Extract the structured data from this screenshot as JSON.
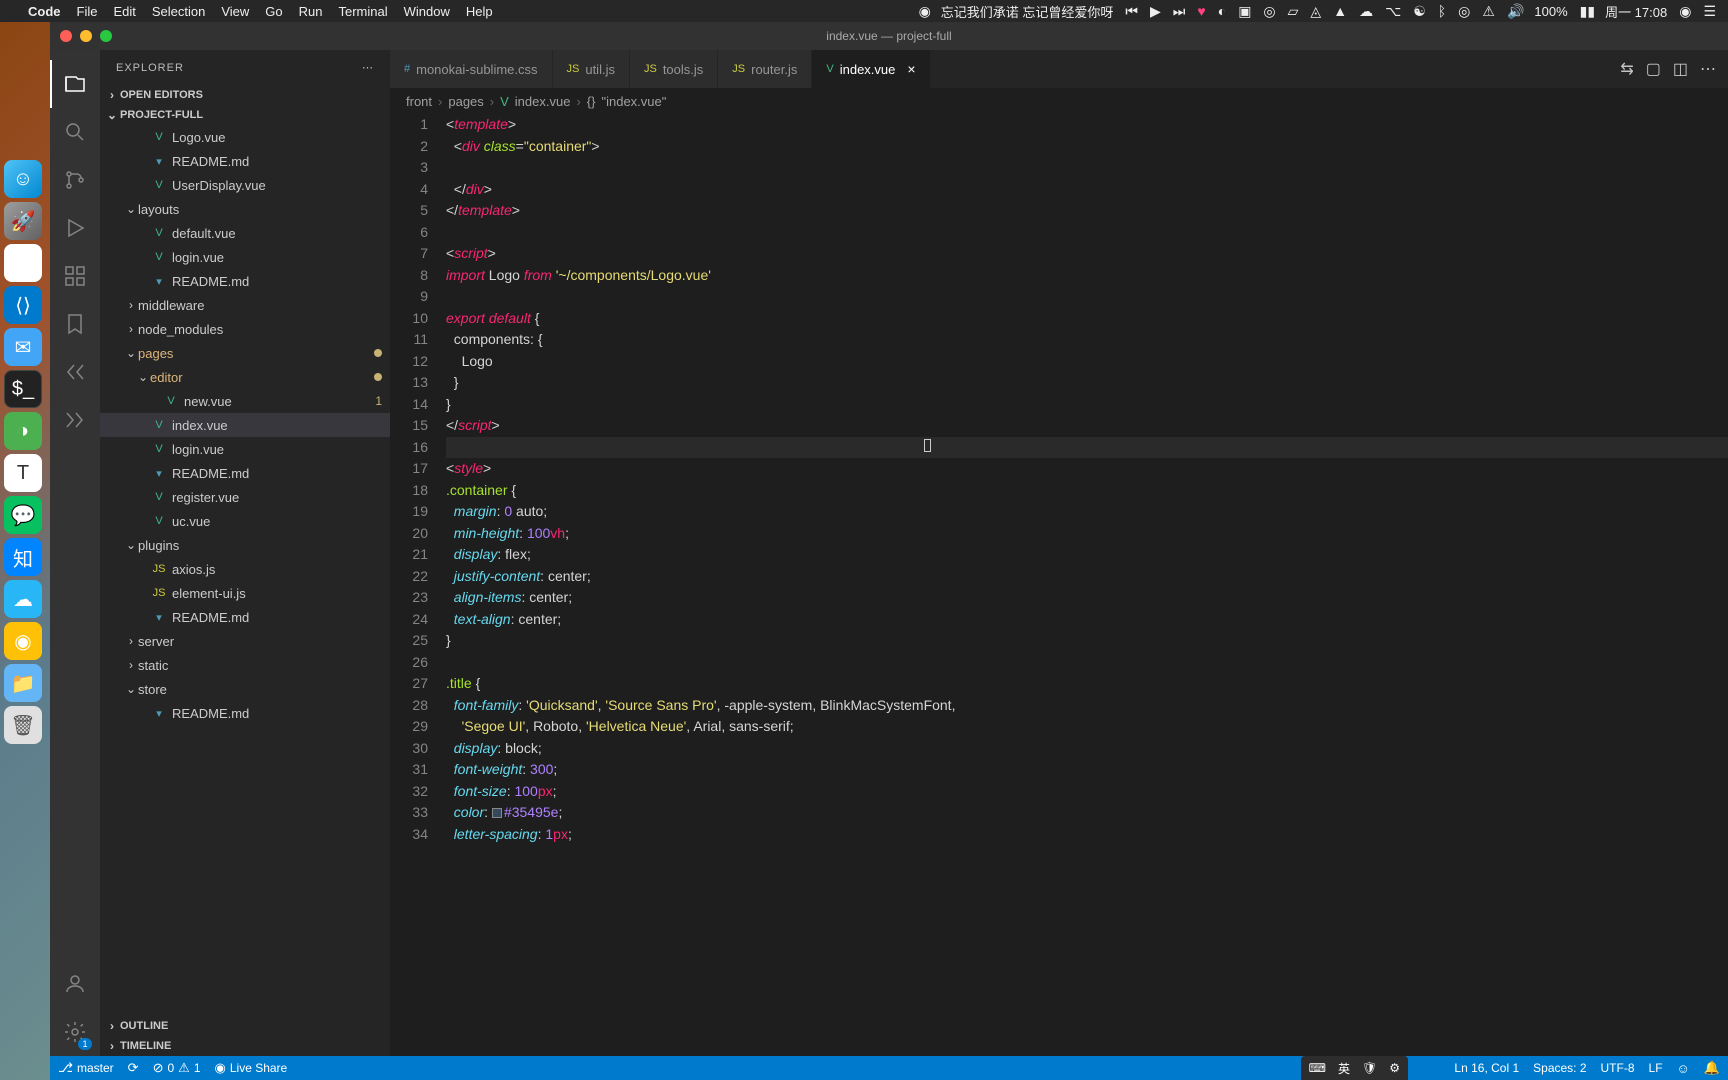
{
  "menubar": {
    "app": "Code",
    "items": [
      "File",
      "Edit",
      "Selection",
      "View",
      "Go",
      "Run",
      "Terminal",
      "Window",
      "Help"
    ],
    "nowplaying": "忘记我们承诺 忘记曾经爱你呀",
    "battery": "100%",
    "day_time": "周一 17:08"
  },
  "window": {
    "title": "index.vue — project-full"
  },
  "sidebar": {
    "title": "EXPLORER",
    "sections": {
      "open_editors": "OPEN EDITORS",
      "project": "PROJECT-FULL",
      "outline": "OUTLINE",
      "timeline": "TIMELINE"
    },
    "tree": [
      {
        "type": "file",
        "name": "Logo.vue",
        "icon": "vue",
        "indent": 3
      },
      {
        "type": "file",
        "name": "README.md",
        "icon": "md",
        "indent": 3
      },
      {
        "type": "file",
        "name": "UserDisplay.vue",
        "icon": "vue",
        "indent": 3
      },
      {
        "type": "folder",
        "name": "layouts",
        "open": true,
        "indent": 2
      },
      {
        "type": "file",
        "name": "default.vue",
        "icon": "vue",
        "indent": 3
      },
      {
        "type": "file",
        "name": "login.vue",
        "icon": "vue",
        "indent": 3
      },
      {
        "type": "file",
        "name": "README.md",
        "icon": "md",
        "indent": 3
      },
      {
        "type": "folder",
        "name": "middleware",
        "open": false,
        "indent": 2
      },
      {
        "type": "folder",
        "name": "node_modules",
        "open": false,
        "indent": 2
      },
      {
        "type": "folder",
        "name": "pages",
        "open": true,
        "indent": 2,
        "modified": true
      },
      {
        "type": "folder",
        "name": "editor",
        "open": true,
        "indent": 3,
        "modified": true
      },
      {
        "type": "file",
        "name": "new.vue",
        "icon": "vue",
        "indent": 4,
        "badge": "1"
      },
      {
        "type": "file",
        "name": "index.vue",
        "icon": "vue",
        "indent": 3,
        "active": true
      },
      {
        "type": "file",
        "name": "login.vue",
        "icon": "vue",
        "indent": 3
      },
      {
        "type": "file",
        "name": "README.md",
        "icon": "md",
        "indent": 3
      },
      {
        "type": "file",
        "name": "register.vue",
        "icon": "vue",
        "indent": 3
      },
      {
        "type": "file",
        "name": "uc.vue",
        "icon": "vue",
        "indent": 3
      },
      {
        "type": "folder",
        "name": "plugins",
        "open": true,
        "indent": 2
      },
      {
        "type": "file",
        "name": "axios.js",
        "icon": "js",
        "indent": 3
      },
      {
        "type": "file",
        "name": "element-ui.js",
        "icon": "js",
        "indent": 3
      },
      {
        "type": "file",
        "name": "README.md",
        "icon": "md",
        "indent": 3
      },
      {
        "type": "folder",
        "name": "server",
        "open": false,
        "indent": 2
      },
      {
        "type": "folder",
        "name": "static",
        "open": false,
        "indent": 2
      },
      {
        "type": "folder",
        "name": "store",
        "open": true,
        "indent": 2
      },
      {
        "type": "file",
        "name": "README.md",
        "icon": "md",
        "indent": 3
      }
    ]
  },
  "tabs": [
    {
      "name": "monokai-sublime.css",
      "icon": "#",
      "iconColor": "#519aba"
    },
    {
      "name": "util.js",
      "icon": "JS",
      "iconColor": "#cbcb41"
    },
    {
      "name": "tools.js",
      "icon": "JS",
      "iconColor": "#cbcb41"
    },
    {
      "name": "router.js",
      "icon": "JS",
      "iconColor": "#cbcb41"
    },
    {
      "name": "index.vue",
      "icon": "V",
      "iconColor": "#41b883",
      "active": true
    }
  ],
  "breadcrumb": [
    "front",
    "pages",
    "index.vue",
    "{}",
    "\"index.vue\""
  ],
  "code": {
    "lines": [
      {
        "n": 1,
        "html": "<span class='c-punc'>&lt;</span><span class='c-tag'>template</span><span class='c-punc'>&gt;</span>"
      },
      {
        "n": 2,
        "html": "  <span class='c-punc'>&lt;</span><span class='c-tag'>div</span> <span class='c-attr'>class</span><span class='c-punc'>=</span><span class='c-str'>\"container\"</span><span class='c-punc'>&gt;</span>"
      },
      {
        "n": 3,
        "html": ""
      },
      {
        "n": 4,
        "html": "  <span class='c-punc'>&lt;/</span><span class='c-tag'>div</span><span class='c-punc'>&gt;</span>"
      },
      {
        "n": 5,
        "html": "<span class='c-punc'>&lt;/</span><span class='c-tag'>template</span><span class='c-punc'>&gt;</span>"
      },
      {
        "n": 6,
        "html": ""
      },
      {
        "n": 7,
        "html": "<span class='c-punc'>&lt;</span><span class='c-tag'>script</span><span class='c-punc'>&gt;</span>"
      },
      {
        "n": 8,
        "html": "<span class='c-kw'>import</span> <span class='c-ident'>Logo</span> <span class='c-kw'>from</span> <span class='c-str'>'~/components/Logo.vue'</span>"
      },
      {
        "n": 9,
        "html": ""
      },
      {
        "n": 10,
        "html": "<span class='c-kw'>export</span> <span class='c-kw'>default</span> <span class='c-punc'>{</span>"
      },
      {
        "n": 11,
        "html": "  <span class='c-ident'>components:</span> <span class='c-punc'>{</span>"
      },
      {
        "n": 12,
        "html": "    <span class='c-ident'>Logo</span>"
      },
      {
        "n": 13,
        "html": "  <span class='c-punc'>}</span>"
      },
      {
        "n": 14,
        "html": "<span class='c-punc'>}</span>"
      },
      {
        "n": 15,
        "html": "<span class='c-punc'>&lt;/</span><span class='c-tag'>script</span><span class='c-punc'>&gt;</span>"
      },
      {
        "n": 16,
        "html": "",
        "current": true
      },
      {
        "n": 17,
        "html": "<span class='c-punc'>&lt;</span><span class='c-tag'>style</span><span class='c-punc'>&gt;</span>"
      },
      {
        "n": 18,
        "html": "<span class='c-class'>.container</span> <span class='c-punc'>{</span>"
      },
      {
        "n": 19,
        "html": "  <span class='c-prop'>margin</span><span class='c-punc'>:</span> <span class='c-num'>0</span> <span class='c-val'>auto</span><span class='c-punc'>;</span>"
      },
      {
        "n": 20,
        "html": "  <span class='c-prop'>min-height</span><span class='c-punc'>:</span> <span class='c-num'>100</span><span class='c-unit'>vh</span><span class='c-punc'>;</span>"
      },
      {
        "n": 21,
        "html": "  <span class='c-prop'>display</span><span class='c-punc'>:</span> <span class='c-val'>flex</span><span class='c-punc'>;</span>"
      },
      {
        "n": 22,
        "html": "  <span class='c-prop'>justify-content</span><span class='c-punc'>:</span> <span class='c-val'>center</span><span class='c-punc'>;</span>"
      },
      {
        "n": 23,
        "html": "  <span class='c-prop'>align-items</span><span class='c-punc'>:</span> <span class='c-val'>center</span><span class='c-punc'>;</span>"
      },
      {
        "n": 24,
        "html": "  <span class='c-prop'>text-align</span><span class='c-punc'>:</span> <span class='c-val'>center</span><span class='c-punc'>;</span>"
      },
      {
        "n": 25,
        "html": "<span class='c-punc'>}</span>"
      },
      {
        "n": 26,
        "html": ""
      },
      {
        "n": 27,
        "html": "<span class='c-class'>.title</span> <span class='c-punc'>{</span>"
      },
      {
        "n": 28,
        "html": "  <span class='c-prop'>font-family</span><span class='c-punc'>:</span> <span class='c-str'>'Quicksand'</span><span class='c-punc'>,</span> <span class='c-str'>'Source Sans Pro'</span><span class='c-punc'>,</span> <span class='c-val'>-apple-system</span><span class='c-punc'>,</span> <span class='c-val'>BlinkMacSystemFont</span><span class='c-punc'>,</span>"
      },
      {
        "n": 29,
        "html": "    <span class='c-str'>'Segoe UI'</span><span class='c-punc'>,</span> <span class='c-val'>Roboto</span><span class='c-punc'>,</span> <span class='c-str'>'Helvetica Neue'</span><span class='c-punc'>,</span> <span class='c-val'>Arial</span><span class='c-punc'>,</span> <span class='c-val'>sans-serif</span><span class='c-punc'>;</span>"
      },
      {
        "n": 30,
        "html": "  <span class='c-prop'>display</span><span class='c-punc'>:</span> <span class='c-val'>block</span><span class='c-punc'>;</span>"
      },
      {
        "n": 31,
        "html": "  <span class='c-prop'>font-weight</span><span class='c-punc'>:</span> <span class='c-num'>300</span><span class='c-punc'>;</span>"
      },
      {
        "n": 32,
        "html": "  <span class='c-prop'>font-size</span><span class='c-punc'>:</span> <span class='c-num'>100</span><span class='c-unit'>px</span><span class='c-punc'>;</span>"
      },
      {
        "n": 33,
        "html": "  <span class='c-prop'>color</span><span class='c-punc'>:</span> <span class='c-colorswatch'></span><span class='c-color'>#35495e</span><span class='c-punc'>;</span>"
      },
      {
        "n": 34,
        "html": "  <span class='c-prop'>letter-spacing</span><span class='c-punc'>:</span> <span class='c-num'>1</span><span class='c-unit'>px</span><span class='c-punc'>;</span>"
      }
    ]
  },
  "statusbar": {
    "branch": "master",
    "errors": "0",
    "warnings": "1",
    "liveshare": "Live Share",
    "position": "Ln 16, Col 1",
    "spaces": "Spaces: 2",
    "encoding": "UTF-8",
    "eol": "LF"
  },
  "ime": {
    "lang": "英"
  }
}
